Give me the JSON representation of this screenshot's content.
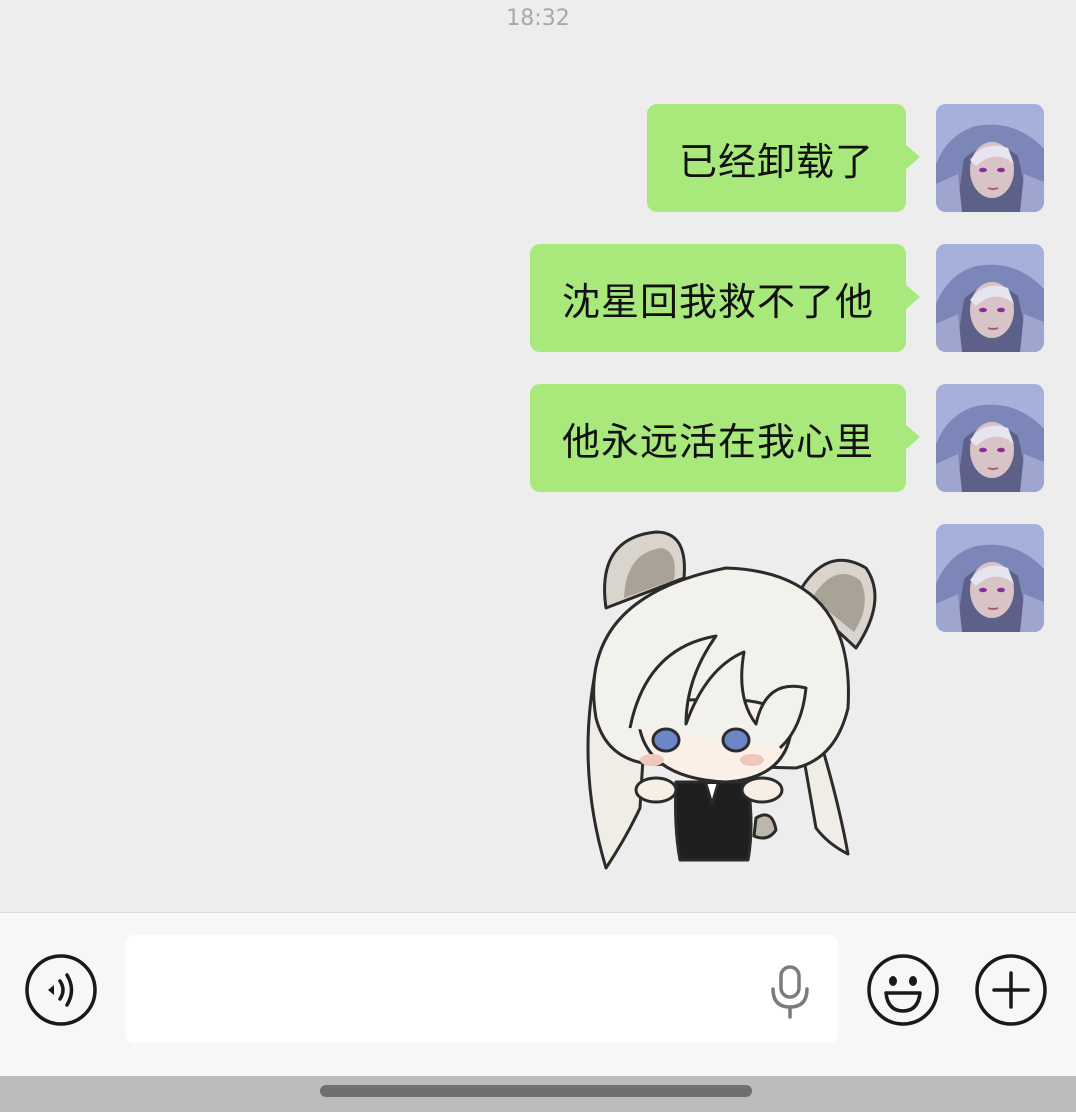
{
  "status": {
    "time": "18:32"
  },
  "messages": [
    {
      "text": "已经卸载了",
      "sender": "me"
    },
    {
      "text": "沈星回我救不了他",
      "sender": "me"
    },
    {
      "text": "他永远活在我心里",
      "sender": "me"
    }
  ],
  "sticker": {
    "icon": "chibi-character-sticker"
  },
  "input": {
    "value": "",
    "placeholder": ""
  },
  "icons": {
    "voice": "voice-toggle-icon",
    "mic": "microphone-icon",
    "emoji": "emoji-icon",
    "plus": "plus-icon"
  },
  "colors": {
    "background": "#ededed",
    "bubble_self": "#a9e97c",
    "input_bar": "#f7f7f7"
  }
}
